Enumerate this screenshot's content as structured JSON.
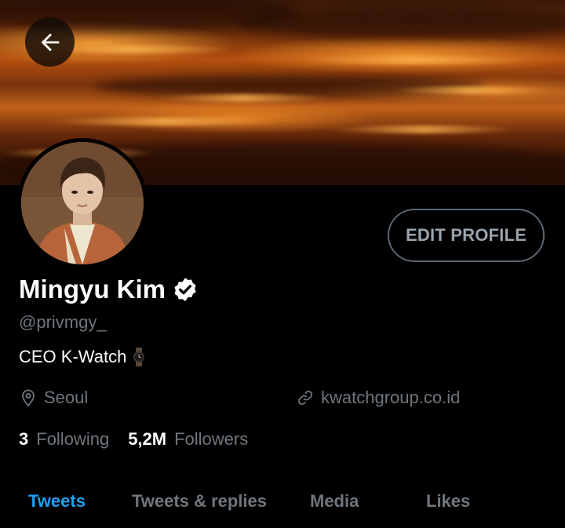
{
  "header": {
    "back_icon": "arrow-left-icon"
  },
  "profile": {
    "name": "Mingyu Kim",
    "verified_icon": "verified-badge-icon",
    "handle": "@privmgy_",
    "bio": "CEO K-Watch",
    "bio_emoji_icon": "watch-icon",
    "location_icon": "location-pin-icon",
    "location": "Seoul",
    "website_icon": "link-icon",
    "website": "kwatchgroup.co.id",
    "following_count": "3",
    "following_label": "Following",
    "followers_count": "5,2M",
    "followers_label": "Followers",
    "edit_profile_label": "EDIT PROFILE"
  },
  "tabs": [
    {
      "label": "Tweets",
      "active": true
    },
    {
      "label": "Tweets & replies",
      "active": false
    },
    {
      "label": "Media",
      "active": false
    },
    {
      "label": "Likes",
      "active": false
    }
  ],
  "colors": {
    "background": "#000000",
    "accent": "#1da1f2",
    "secondary_text": "#6e767d",
    "banner_orange": "#c2621a"
  }
}
